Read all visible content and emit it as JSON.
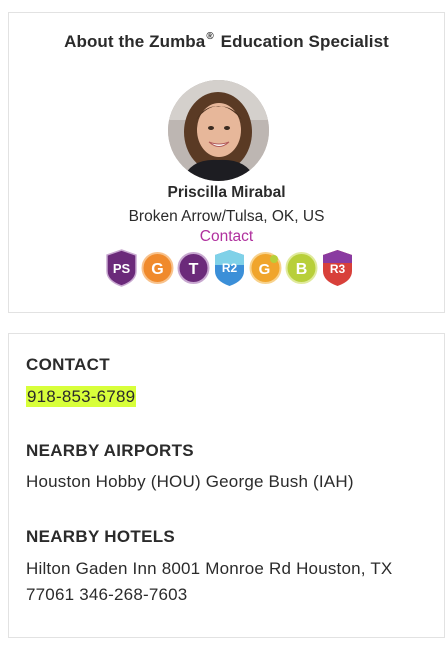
{
  "about": {
    "title_prefix": "About the Zumba",
    "title_mark": "®",
    "title_suffix": "Education Specialist",
    "name": "Priscilla Mirabal",
    "location": "Broken Arrow/Tulsa, OK, US",
    "contact_label": "Contact",
    "badges": [
      {
        "label": "PS",
        "color": "#6b2a7a",
        "icon": "ps-badge-icon"
      },
      {
        "label": "G",
        "color": "#f08a2c",
        "icon": "g-badge-icon"
      },
      {
        "label": "T",
        "color": "#6b2a7a",
        "icon": "t-badge-icon"
      },
      {
        "label": "R2",
        "color": "#3b8fd8",
        "icon": "r2-badge-icon"
      },
      {
        "label": "G",
        "color": "#f0a52c",
        "icon": "g-bronze-badge-icon"
      },
      {
        "label": "B",
        "color": "#b8cf3a",
        "icon": "b-badge-icon"
      },
      {
        "label": "R3",
        "color": "#d8403a",
        "icon": "r3-badge-icon"
      }
    ]
  },
  "info": {
    "contact_heading": "CONTACT",
    "phone": "918-853-6789",
    "airports_heading": "NEARBY AIRPORTS",
    "airports_text": "Houston Hobby (HOU) George Bush (IAH)",
    "hotels_heading": "NEARBY HOTELS",
    "hotels_line1": "Hilton Gaden Inn 8001 Monroe Rd Houston, TX",
    "hotels_line2": "77061 346-268-7603"
  }
}
